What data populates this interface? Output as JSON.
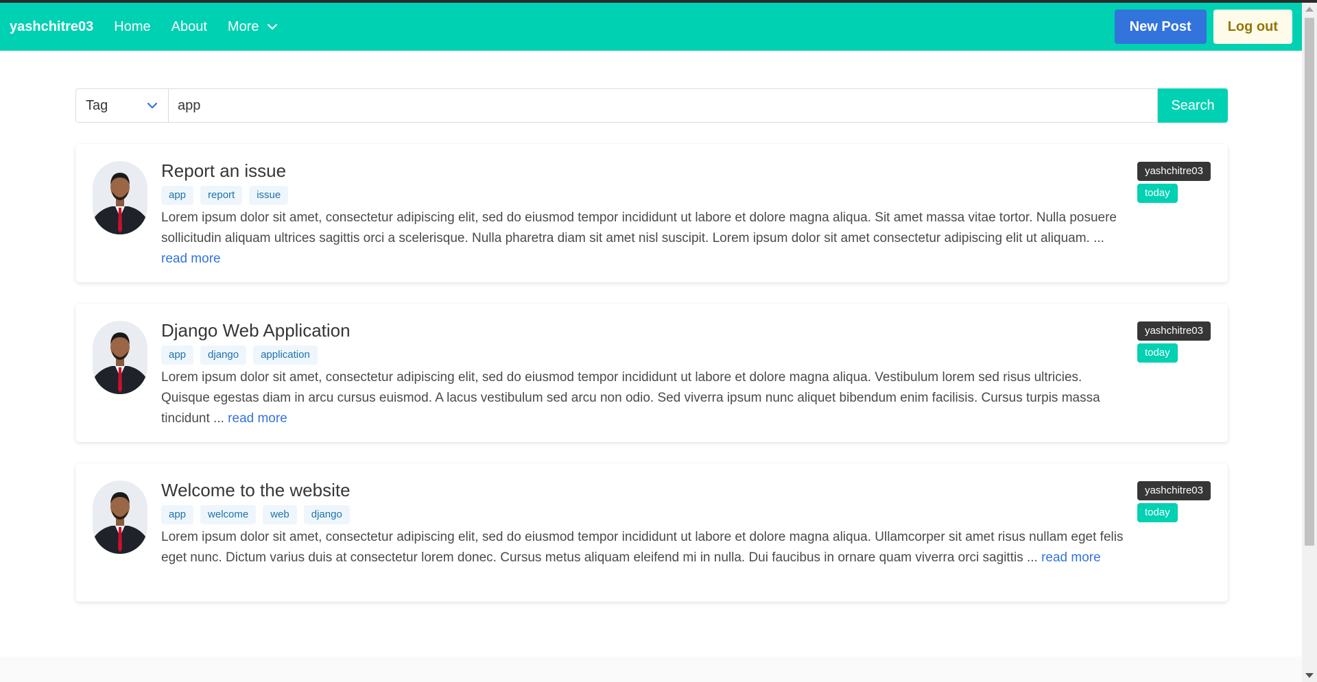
{
  "navbar": {
    "brand": "yashchitre03",
    "links": [
      "Home",
      "About",
      "More"
    ],
    "new_post_label": "New Post",
    "logout_label": "Log out"
  },
  "search": {
    "filter_label": "Tag",
    "query": "app",
    "button_label": "Search"
  },
  "posts": [
    {
      "title": "Report an issue",
      "tags": [
        "app",
        "report",
        "issue"
      ],
      "excerpt": "Lorem ipsum dolor sit amet, consectetur adipiscing elit, sed do eiusmod tempor incididunt ut labore et dolore magna aliqua. Sit amet massa vitae tortor. Nulla posuere sollicitudin aliquam ultrices sagittis orci a scelerisque. Nulla pharetra diam sit amet nisl suscipit. Lorem ipsum dolor sit amet consectetur adipiscing elit ut aliquam. ...",
      "read_more": "read more",
      "author": "yashchitre03",
      "date": "today"
    },
    {
      "title": "Django Web Application",
      "tags": [
        "app",
        "django",
        "application"
      ],
      "excerpt": "Lorem ipsum dolor sit amet, consectetur adipiscing elit, sed do eiusmod tempor incididunt ut labore et dolore magna aliqua. Vestibulum lorem sed risus ultricies. Quisque egestas diam in arcu cursus euismod. A lacus vestibulum sed arcu non odio. Sed viverra ipsum nunc aliquet bibendum enim facilisis. Cursus turpis massa tincidunt ...",
      "read_more": "read more",
      "author": "yashchitre03",
      "date": "today"
    },
    {
      "title": "Welcome to the website",
      "tags": [
        "app",
        "welcome",
        "web",
        "django"
      ],
      "excerpt": "Lorem ipsum dolor sit amet, consectetur adipiscing elit, sed do eiusmod tempor incididunt ut labore et dolore magna aliqua. Ullamcorper sit amet risus nullam eget felis eget nunc. Dictum varius duis at consectetur lorem donec. Cursus metus aliquam eleifend mi in nulla. Dui faucibus in ornare quam viverra orci sagittis ...",
      "read_more": "read more",
      "author": "yashchitre03",
      "date": "today"
    }
  ],
  "colors": {
    "primary": "#00d1b2",
    "link": "#3273dc",
    "dark": "#363636"
  }
}
